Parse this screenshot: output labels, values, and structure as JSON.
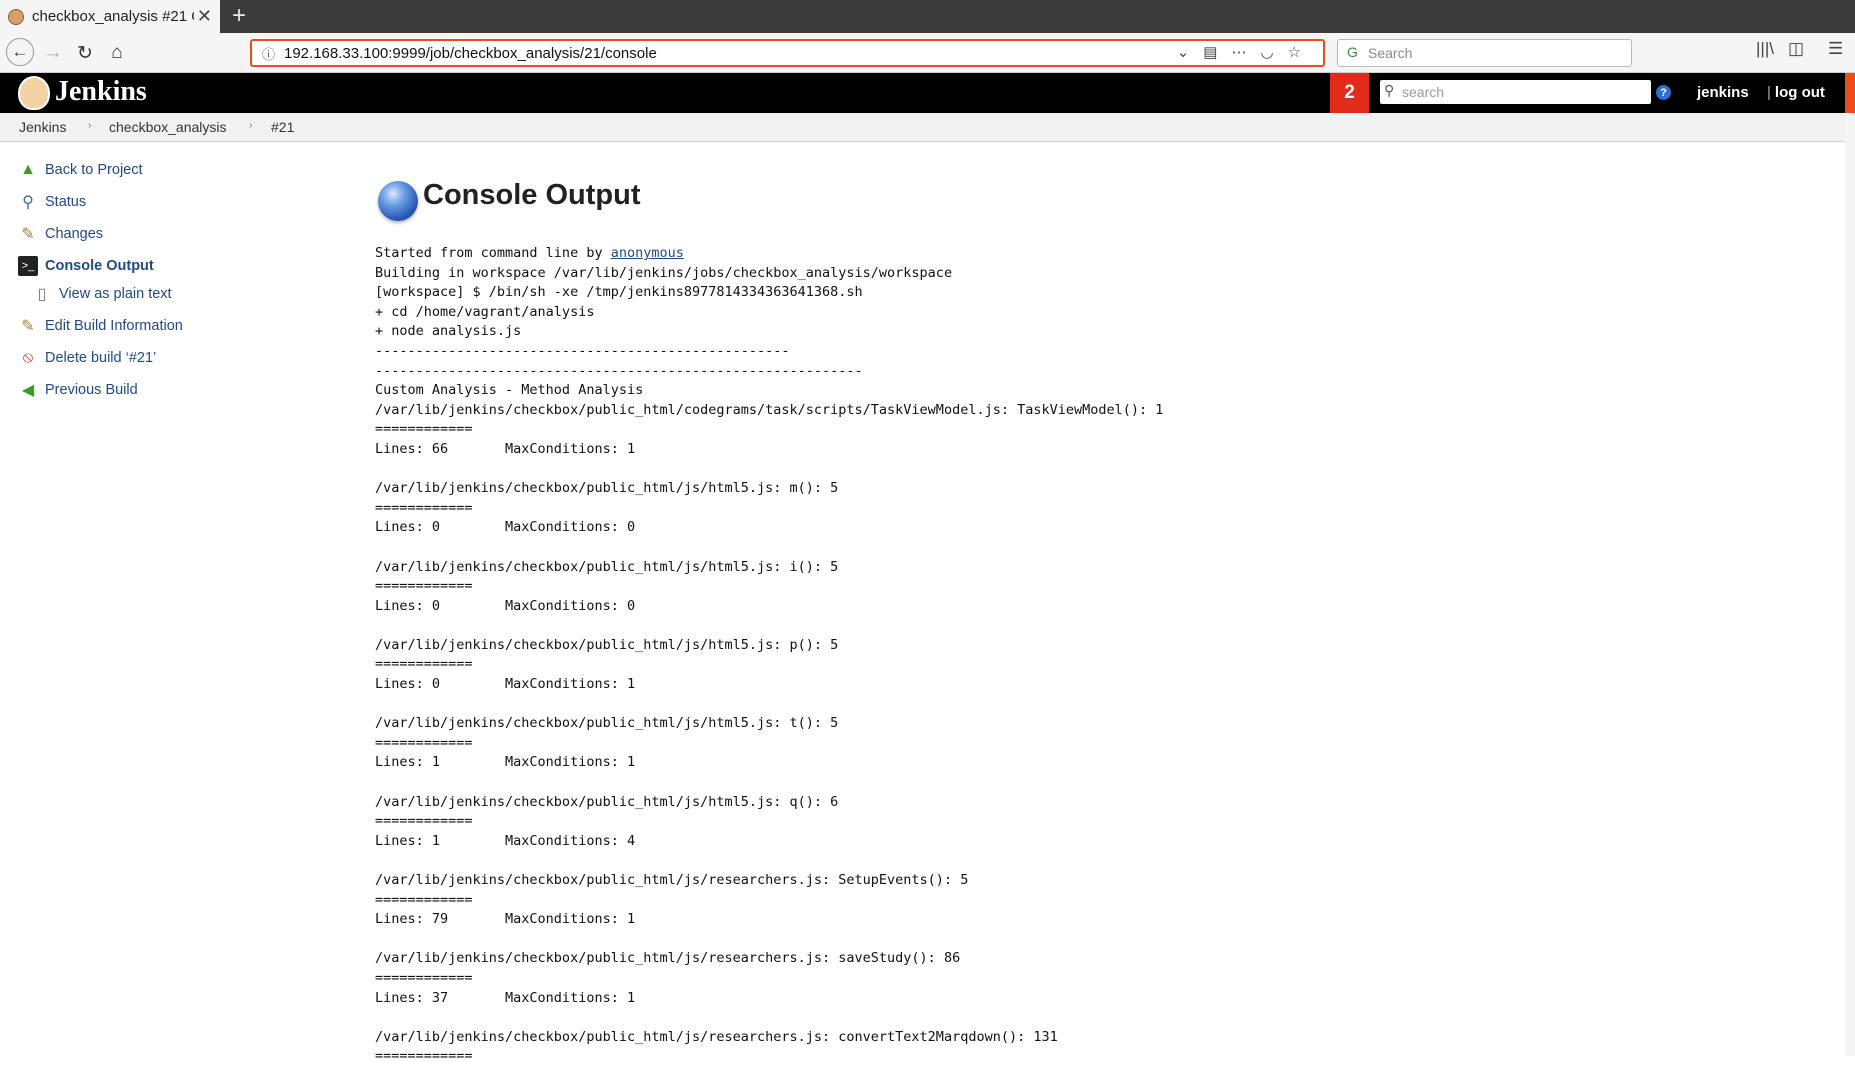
{
  "browser": {
    "tab_title": "checkbox_analysis #21 C",
    "url": "192.168.33.100:9999/job/checkbox_analysis/21/console",
    "search_placeholder": "Search"
  },
  "header": {
    "brand": "Jenkins",
    "notification_count": "2",
    "search_placeholder": "search",
    "help": "?",
    "user": "jenkins",
    "logout_sep": "|",
    "logout": "log out",
    "colors": {
      "badge": "#e12b1b",
      "accent": "#e84e1b",
      "link": "#204a87"
    }
  },
  "breadcrumb": [
    "Jenkins",
    "checkbox_analysis",
    "#21"
  ],
  "sidebar": {
    "items": [
      {
        "label": "Back to Project",
        "icon": "up-arrow-icon"
      },
      {
        "label": "Status",
        "icon": "magnifier-icon"
      },
      {
        "label": "Changes",
        "icon": "notepad-icon"
      },
      {
        "label": "Console Output",
        "icon": "terminal-icon",
        "active": true
      },
      {
        "label": "View as plain text",
        "icon": "document-icon"
      },
      {
        "label": "Edit Build Information",
        "icon": "notepad-icon"
      },
      {
        "label": "Delete build ‘#21’",
        "icon": "no-entry-icon"
      },
      {
        "label": "Previous Build",
        "icon": "left-arrow-icon"
      }
    ]
  },
  "main": {
    "title": "Console Output",
    "started_prefix": "Started from command line by ",
    "started_user": "anonymous",
    "lines": [
      "Building in workspace /var/lib/jenkins/jobs/checkbox_analysis/workspace",
      "[workspace] $ /bin/sh -xe /tmp/jenkins8977814334363641368.sh",
      "+ cd /home/vagrant/analysis",
      "+ node analysis.js",
      "---------------------------------------------------",
      "------------------------------------------------------------",
      "Custom Analysis - Method Analysis",
      "/var/lib/jenkins/checkbox/public_html/codegrams/task/scripts/TaskViewModel.js: TaskViewModel(): 1",
      "============",
      "Lines: 66       MaxConditions: 1",
      "",
      "/var/lib/jenkins/checkbox/public_html/js/html5.js: m(): 5",
      "============",
      "Lines: 0        MaxConditions: 0",
      "",
      "/var/lib/jenkins/checkbox/public_html/js/html5.js: i(): 5",
      "============",
      "Lines: 0        MaxConditions: 0",
      "",
      "/var/lib/jenkins/checkbox/public_html/js/html5.js: p(): 5",
      "============",
      "Lines: 0        MaxConditions: 1",
      "",
      "/var/lib/jenkins/checkbox/public_html/js/html5.js: t(): 5",
      "============",
      "Lines: 1        MaxConditions: 1",
      "",
      "/var/lib/jenkins/checkbox/public_html/js/html5.js: q(): 6",
      "============",
      "Lines: 1        MaxConditions: 4",
      "",
      "/var/lib/jenkins/checkbox/public_html/js/researchers.js: SetupEvents(): 5",
      "============",
      "Lines: 79       MaxConditions: 1",
      "",
      "/var/lib/jenkins/checkbox/public_html/js/researchers.js: saveStudy(): 86",
      "============",
      "Lines: 37       MaxConditions: 1",
      "",
      "/var/lib/jenkins/checkbox/public_html/js/researchers.js: convertText2Marqdown(): 131",
      "============"
    ]
  }
}
